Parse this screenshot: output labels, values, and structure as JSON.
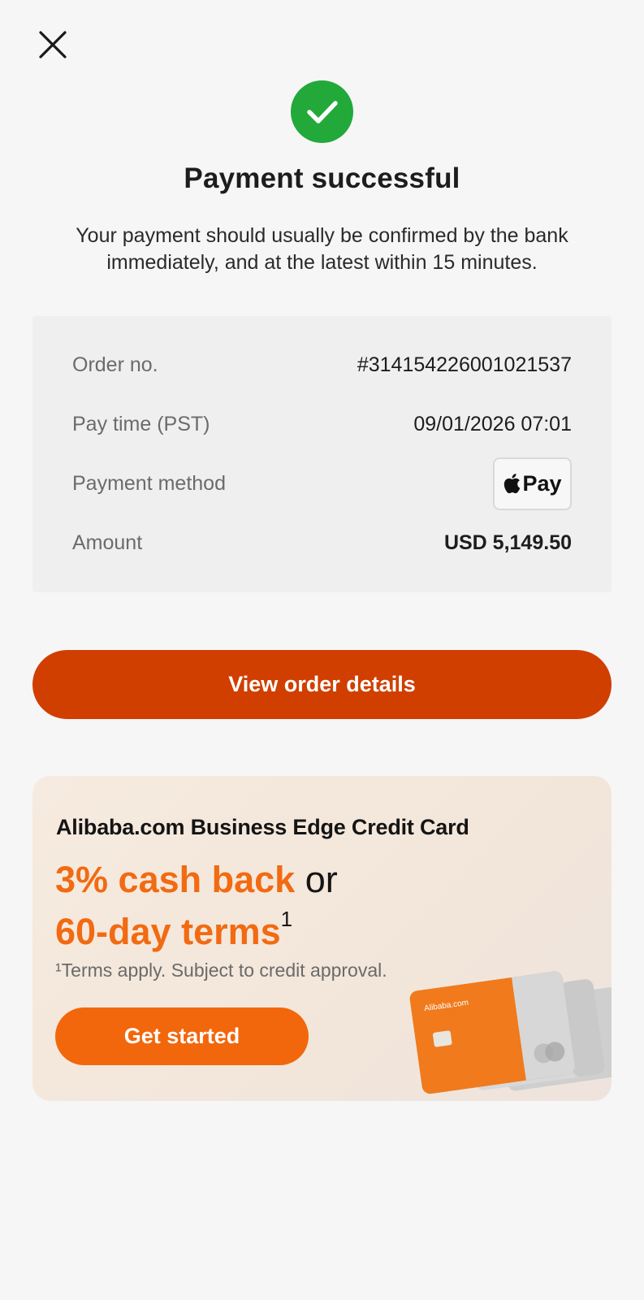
{
  "header": {
    "close_icon": "close-icon"
  },
  "status": {
    "icon": "check-circle-icon",
    "icon_color": "#22a93a",
    "title": "Payment successful",
    "message": "Your payment should usually be confirmed by the bank immediately, and at the latest within 15 minutes."
  },
  "details": {
    "rows": [
      {
        "label": "Order no.",
        "value": "#3141542260010215 37"
      },
      {
        "label": "Pay time (PST)",
        "value": "09/01/2026 07:01"
      },
      {
        "label": "Payment method",
        "value": "Pay",
        "icon": "apple-icon"
      },
      {
        "label": "Amount",
        "value": "USD 5,149.50"
      }
    ]
  },
  "primary_action": {
    "label": "View order details",
    "color": "#d03f00"
  },
  "promo": {
    "title": "Alibaba.com Business Edge Credit Card",
    "headline_part1": "3% cash back",
    "headline_or": "or",
    "headline_part2": "60-day terms",
    "headline_sup": "1",
    "note": "¹Terms apply. Subject to credit approval.",
    "button_label": "Get started",
    "accent_color": "#f26a12",
    "card_brand": "Alibaba.com"
  }
}
